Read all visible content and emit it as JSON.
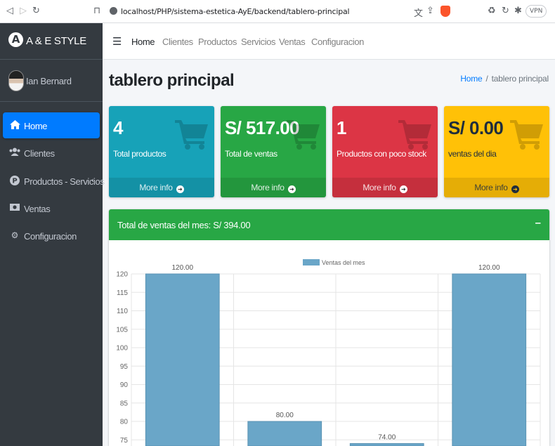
{
  "browser": {
    "url": "localhost/PHP/sistema-estetica-AyE/backend/tablero-principal",
    "vpn_label": "VPN"
  },
  "brand": {
    "logo_letter": "A",
    "name": "A & E STYLE"
  },
  "user": {
    "name": "Ian Bernard"
  },
  "sidebar": {
    "items": [
      {
        "label": "Home",
        "icon": "home-icon",
        "active": true
      },
      {
        "label": "Clientes",
        "icon": "users-icon",
        "active": false
      },
      {
        "label": "Productos - Servicios",
        "icon": "product-p-icon",
        "active": false,
        "has_caret": true
      },
      {
        "label": "Ventas",
        "icon": "money-icon",
        "active": false
      },
      {
        "label": "Configuracion",
        "icon": "gear-icon",
        "active": false
      }
    ]
  },
  "topnav": {
    "links": [
      "Home",
      "Clientes",
      "Productos",
      "Servicios",
      "Ventas",
      "Configuracion"
    ]
  },
  "page": {
    "title": "tablero principal",
    "breadcrumb": {
      "home": "Home",
      "current": "tablero principal"
    }
  },
  "boxes": [
    {
      "value": "4",
      "label": "Total productos",
      "link": "More info",
      "color": "#17a2b8"
    },
    {
      "value": "S/ 517.00",
      "label": "Total de ventas",
      "link": "More info",
      "color": "#28a745"
    },
    {
      "value": "1",
      "label": "Productos con poco stock",
      "link": "More info",
      "color": "#dc3545"
    },
    {
      "value": "S/ 0.00",
      "label": "ventas del dia",
      "link": "More info",
      "color": "#ffc107"
    }
  ],
  "sales_card": {
    "title": "Total de ventas del mes: S/ 394.00",
    "collapse_symbol": "–"
  },
  "chart_data": {
    "type": "bar",
    "categories": [
      "",
      "",
      "",
      ""
    ],
    "series": [
      {
        "name": "Ventas del mes",
        "values": [
          120.0,
          80.0,
          74.0,
          120.0
        ],
        "color": "#6aa6c8"
      }
    ],
    "data_labels": [
      "120.00",
      "80.00",
      "74.00",
      "120.00"
    ],
    "yticks": [
      120,
      115,
      110,
      105,
      100,
      95,
      90,
      85,
      80,
      75
    ],
    "ylim": [
      73,
      120
    ],
    "grid": true,
    "legend": "top-center",
    "title": "",
    "xlabel": "",
    "ylabel": ""
  }
}
